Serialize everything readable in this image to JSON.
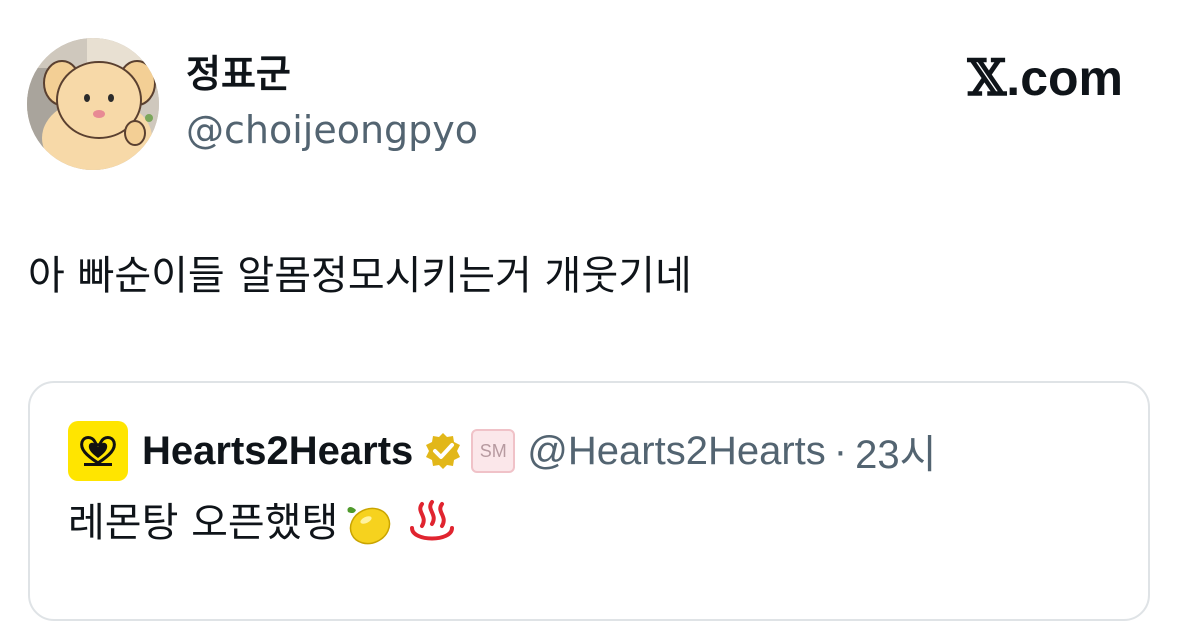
{
  "author": {
    "display_name": "정표군",
    "handle": "@choijeongpyo"
  },
  "brand": {
    "logo_glyph": "𝕏",
    "suffix": ".com"
  },
  "tweet": {
    "text": "아 빠순이들 알몸정모시키는거 개웃기네"
  },
  "quoted_tweet": {
    "name": "Hearts2Hearts",
    "verified_icon": "verified-gold-badge-icon",
    "affiliate_badge": "SM",
    "handle": "@Hearts2Hearts",
    "separator": "·",
    "time": "23시",
    "text": "레몬탕 오픈했탱",
    "emoji": [
      "lemon-icon",
      "hot-springs-icon"
    ]
  },
  "colors": {
    "text_primary": "#0f1419",
    "text_secondary": "#536471",
    "border": "#dfe3e6",
    "quote_avatar_bg": "#ffe500",
    "verified_gold": "#e2b719"
  }
}
